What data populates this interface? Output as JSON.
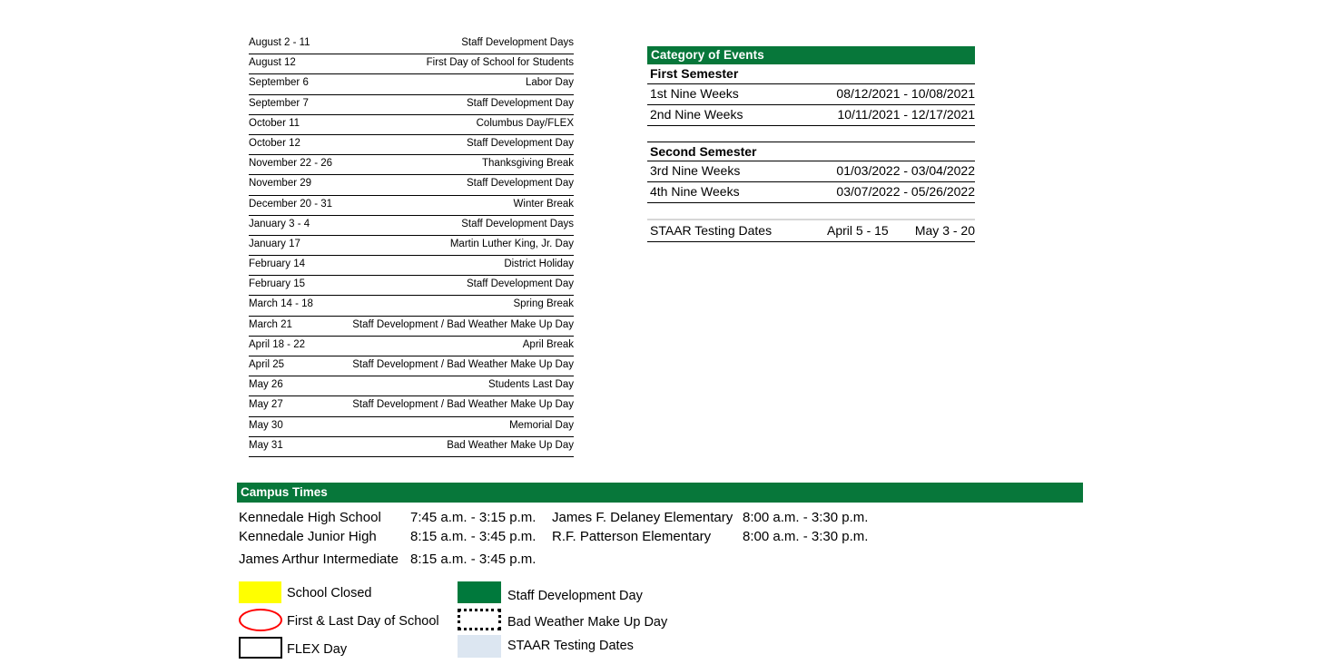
{
  "colors": {
    "brand_green": "#07773a",
    "legend_green": "#00793c",
    "legend_yellow": "#ffff00",
    "legend_red": "#ff0000",
    "legend_staar_blue": "#dce6f1"
  },
  "events": {
    "rows": [
      {
        "date": "August 2 - 11",
        "name": "Staff Development Days"
      },
      {
        "date": "August 12",
        "name": "First Day of School for Students"
      },
      {
        "date": "September 6",
        "name": "Labor Day"
      },
      {
        "date": "September 7",
        "name": "Staff Development Day"
      },
      {
        "date": "October 11",
        "name": "Columbus Day/FLEX"
      },
      {
        "date": "October 12",
        "name": "Staff Development Day"
      },
      {
        "date": "November 22 - 26",
        "name": "Thanksgiving Break"
      },
      {
        "date": "November 29",
        "name": "Staff Development Day"
      },
      {
        "date": "December 20 - 31",
        "name": "Winter Break"
      },
      {
        "date": "January 3 - 4",
        "name": "Staff Development Days"
      },
      {
        "date": "January 17",
        "name": "Martin Luther King, Jr. Day"
      },
      {
        "date": "February 14",
        "name": "District Holiday"
      },
      {
        "date": "February 15",
        "name": "Staff Development Day"
      },
      {
        "date": "March 14 - 18",
        "name": "Spring Break"
      },
      {
        "date": "March 21",
        "name": "Staff Development / Bad Weather Make Up Day"
      },
      {
        "date": "April 18 - 22",
        "name": "April Break"
      },
      {
        "date": "April 25",
        "name": "Staff Development / Bad Weather Make Up Day"
      },
      {
        "date": "May 26",
        "name": "Students Last Day"
      },
      {
        "date": "May 27",
        "name": "Staff Development / Bad Weather Make Up Day"
      },
      {
        "date": "May 30",
        "name": "Memorial Day"
      },
      {
        "date": "May 31",
        "name": "Bad Weather Make Up Day"
      },
      {
        "date": "",
        "name": ""
      },
      {
        "date": "",
        "name": ""
      }
    ]
  },
  "category": {
    "header": "Category of Events",
    "first_semester_label": "First Semester",
    "first_semester_rows": [
      {
        "label": "1st Nine Weeks",
        "value": "08/12/2021 - 10/08/2021"
      },
      {
        "label": "2nd Nine Weeks",
        "value": "10/11/2021 - 12/17/2021"
      }
    ],
    "second_semester_label": "Second Semester",
    "second_semester_rows": [
      {
        "label": "3rd Nine Weeks",
        "value": "01/03/2022 - 03/04/2022"
      },
      {
        "label": "4th Nine Weeks",
        "value": "03/07/2022 - 05/26/2022"
      }
    ],
    "staar": {
      "label": "STAAR Testing Dates",
      "date_1": "April 5 - 15",
      "date_2": "May 3 - 20"
    }
  },
  "campus_times": {
    "header": "Campus Times",
    "left_column": [
      {
        "name": "Kennedale High School",
        "time": "7:45 a.m. - 3:15 p.m."
      },
      {
        "name": "Kennedale Junior High",
        "time": "8:15 a.m. - 3:45 p.m."
      },
      {
        "name": "James Arthur Intermediate",
        "time": "8:15 a.m. - 3:45 p.m."
      }
    ],
    "right_column": [
      {
        "name": "James F. Delaney Elementary",
        "time": "8:00 a.m. - 3:30 p.m."
      },
      {
        "name": "R.F. Patterson Elementary",
        "time": "8:00 a.m. - 3:30 p.m."
      }
    ]
  },
  "legend": {
    "school_closed": "School Closed",
    "first_last_day": "First & Last Day of School",
    "flex_day": "FLEX Day",
    "staff_development": "Staff Development Day",
    "bad_weather": "Bad Weather Make Up Day",
    "staar_testing": "STAAR Testing Dates"
  }
}
